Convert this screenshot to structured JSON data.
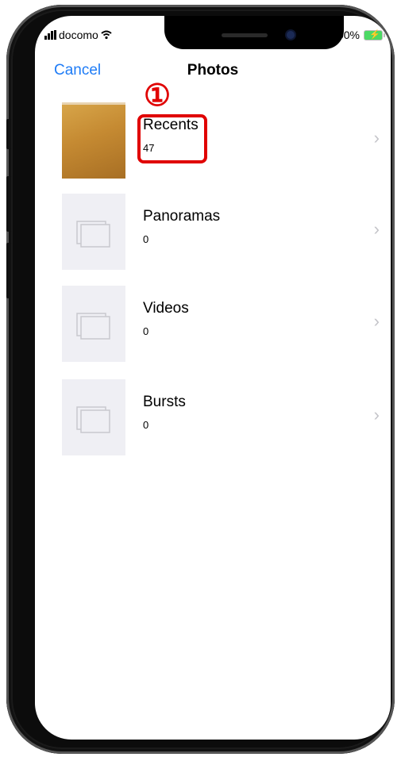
{
  "status_bar": {
    "carrier": "docomo",
    "battery": "100%"
  },
  "nav": {
    "cancel_label": "Cancel",
    "title": "Photos"
  },
  "annotation": {
    "marker": "①",
    "color": "#e00000"
  },
  "albums": [
    {
      "title": "Recents",
      "count": "47",
      "thumbnail": "photo"
    },
    {
      "title": "Panoramas",
      "count": "0",
      "thumbnail": "empty-album-icon"
    },
    {
      "title": "Videos",
      "count": "0",
      "thumbnail": "empty-album-icon"
    },
    {
      "title": "Bursts",
      "count": "0",
      "thumbnail": "empty-album-icon"
    }
  ],
  "colors": {
    "accent": "#1f7cf6",
    "placeholder": "#efeff4",
    "chevron": "#c4c4c9"
  }
}
